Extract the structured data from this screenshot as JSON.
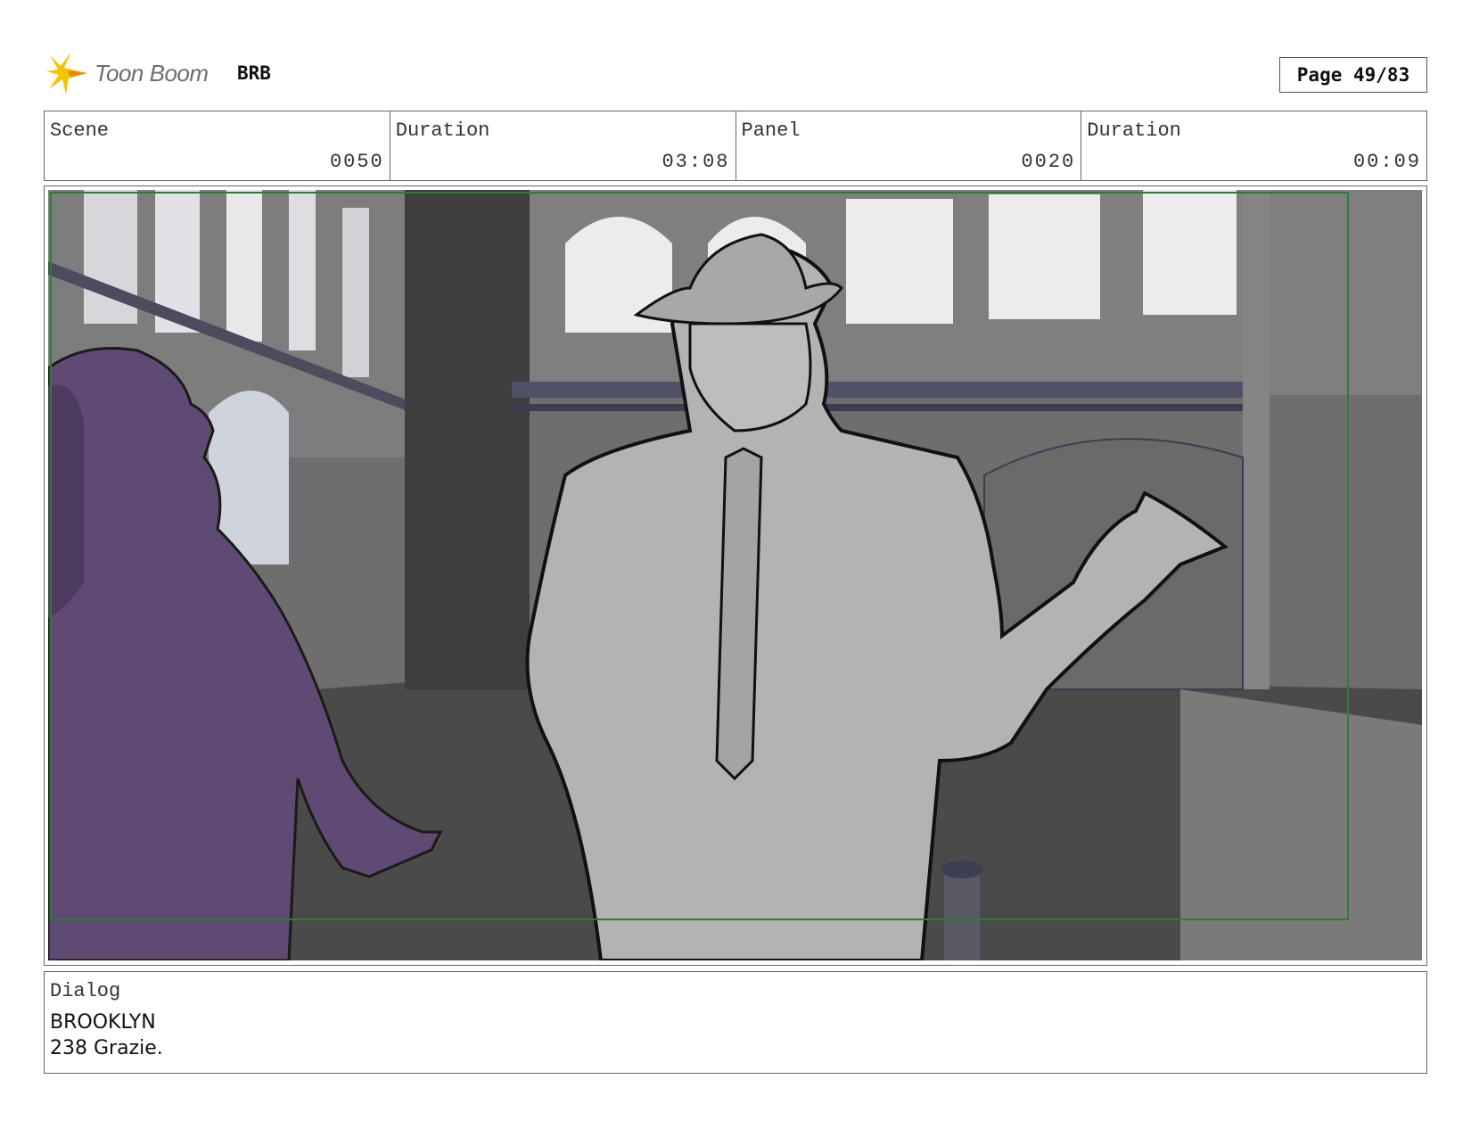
{
  "header": {
    "brand": "Toon Boom",
    "logo_icon": "starburst-icon",
    "project": "BRB",
    "page": "Page 49/83"
  },
  "info": {
    "scene_label": "Scene",
    "scene_value": "0050",
    "scene_duration_label": "Duration",
    "scene_duration_value": "03:08",
    "panel_label": "Panel",
    "panel_value": "0020",
    "panel_duration_label": "Duration",
    "panel_duration_value": "00:09"
  },
  "dialog": {
    "label": "Dialog",
    "line1": "BROOKLYN",
    "line2": "238 Grazie."
  },
  "colors": {
    "frame_border": "#2e7d32",
    "woman_fill": "#5e4a72",
    "man_fill": "#b3b3b3",
    "background_wall": "#6e6e6e"
  }
}
